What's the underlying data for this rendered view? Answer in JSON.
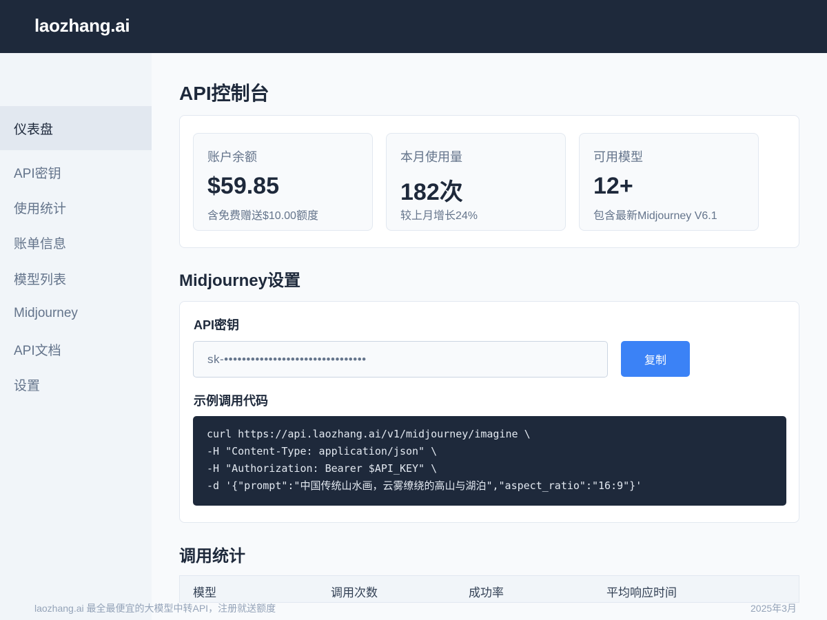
{
  "header": {
    "logo": "laozhang.ai"
  },
  "sidebar": {
    "items": [
      {
        "label": "仪表盘",
        "active": true
      },
      {
        "label": "API密钥"
      },
      {
        "label": "使用统计"
      },
      {
        "label": "账单信息"
      },
      {
        "label": "模型列表"
      },
      {
        "label": "Midjourney"
      },
      {
        "label": "API文档"
      },
      {
        "label": "设置"
      }
    ]
  },
  "main": {
    "title": "API控制台",
    "stats": [
      {
        "label": "账户余额",
        "value": "$59.85",
        "note": "含免费赠送$10.00额度"
      },
      {
        "label": "本月使用量",
        "value": "182次",
        "note": "较上月增长24%"
      },
      {
        "label": "可用模型",
        "value": "12+",
        "note": "包含最新Midjourney V6.1"
      }
    ],
    "midjourney": {
      "title": "Midjourney设置",
      "key_label": "API密钥",
      "key_value": "sk-••••••••••••••••••••••••••••••••",
      "copy_label": "复制",
      "code_label": "示例调用代码",
      "code_lines": [
        "curl https://api.laozhang.ai/v1/midjourney/imagine \\",
        "-H \"Content-Type: application/json\" \\",
        "-H \"Authorization: Bearer $API_KEY\" \\",
        "-d '{\"prompt\":\"中国传统山水画，云雾缭绕的高山与湖泊\",\"aspect_ratio\":\"16:9\"}'"
      ]
    },
    "usage": {
      "title": "调用统计",
      "columns": [
        "模型",
        "调用次数",
        "成功率",
        "平均响应时间"
      ]
    }
  },
  "footer": {
    "left": "laozhang.ai 最全最便宜的大模型中转API，注册就送额度",
    "right": "2025年3月"
  },
  "colors": {
    "topbar": "#1e293b",
    "accent": "#3b82f6",
    "sidebar_bg": "#f1f5f9",
    "code_bg": "#1e293b"
  }
}
